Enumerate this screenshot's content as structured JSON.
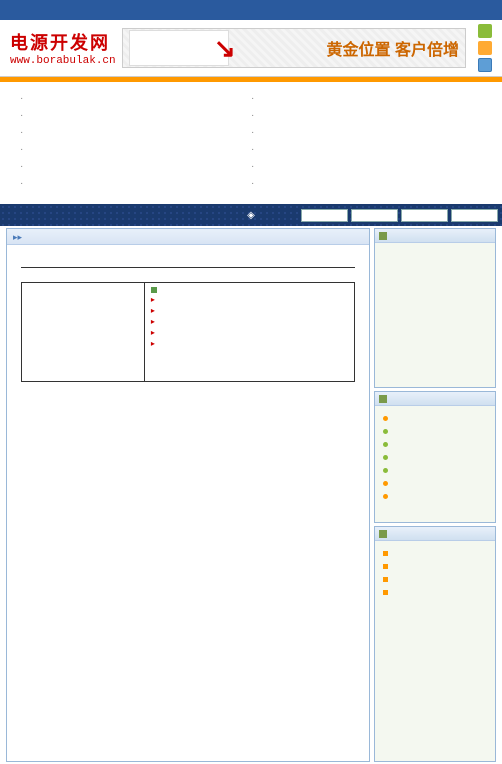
{
  "header": {
    "logo_text": "电源开发网",
    "logo_url": "www.borabulak.cn",
    "banner_text": "黄金位置 客户倍增"
  },
  "link_grid": {
    "rows": [
      {
        "left": "",
        "right": ""
      },
      {
        "left": "",
        "right": ""
      },
      {
        "left": "",
        "right": ""
      },
      {
        "left": "",
        "right": ""
      },
      {
        "left": "",
        "right": ""
      },
      {
        "left": "",
        "right": ""
      }
    ]
  },
  "nav": {
    "icon": "◈",
    "buttons": [
      "",
      "",
      "",
      ""
    ]
  },
  "content": {
    "detail_items": [
      "",
      "",
      "",
      "",
      "",
      ""
    ]
  },
  "sidebar": {
    "box2_items": [
      "",
      "",
      "",
      "",
      "",
      "",
      ""
    ],
    "box3_items": [
      "",
      "",
      "",
      ""
    ]
  }
}
